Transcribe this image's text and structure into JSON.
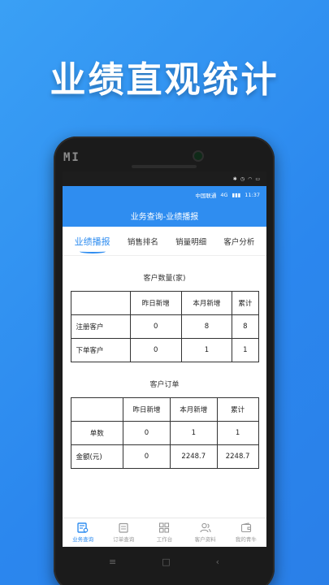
{
  "headline": "业绩直观统计",
  "phone": {
    "brand": "MI"
  },
  "status_bar": {
    "time": "11:37",
    "icons": [
      "bluetooth-icon",
      "alarm-icon",
      "wifi-icon",
      "battery-icon"
    ]
  },
  "carrier_bar": {
    "carrier": "中国联通",
    "network": "4G",
    "time": "11:37"
  },
  "header": {
    "title": "业务查询-业绩播报"
  },
  "tabs": [
    {
      "label": "业绩播报",
      "active": true
    },
    {
      "label": "销售排名",
      "active": false
    },
    {
      "label": "销量明细",
      "active": false
    },
    {
      "label": "客户分析",
      "active": false
    }
  ],
  "customer_count": {
    "title": "客户数量(家)",
    "columns": [
      "",
      "昨日新增",
      "本月新增",
      "累计"
    ],
    "rows": [
      [
        "注册客户",
        "0",
        "8",
        "8"
      ],
      [
        "下单客户",
        "0",
        "1",
        "1"
      ]
    ]
  },
  "customer_orders": {
    "title": "客户订单",
    "columns": [
      "",
      "昨日新增",
      "本月新增",
      "累计"
    ],
    "rows": [
      [
        "单数",
        "0",
        "1",
        "1"
      ],
      [
        "金额(元)",
        "0",
        "2248.7",
        "2248.7"
      ]
    ]
  },
  "bottom_nav": [
    {
      "label": "业务查询",
      "icon": "business-query-icon",
      "active": true
    },
    {
      "label": "订单查询",
      "icon": "order-query-icon",
      "active": false
    },
    {
      "label": "工作台",
      "icon": "workbench-icon",
      "active": false
    },
    {
      "label": "客户资料",
      "icon": "customers-icon",
      "active": false
    },
    {
      "label": "我的青牛",
      "icon": "wallet-icon",
      "active": false
    }
  ],
  "colors": {
    "accent": "#2f8df0",
    "background": "#2b87ee",
    "header": "#2f8df0"
  }
}
